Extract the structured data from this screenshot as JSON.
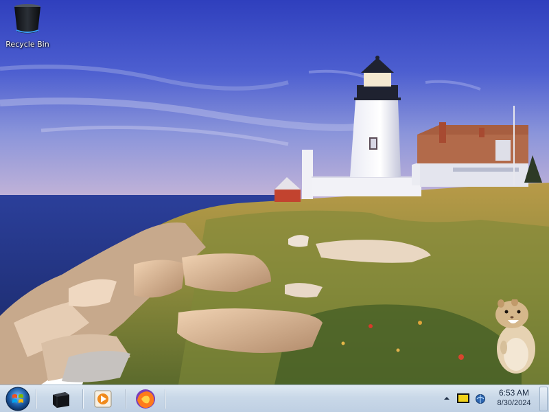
{
  "desktop": {
    "icons": [
      {
        "label": "Recycle Bin",
        "icon": "recycle-bin-icon"
      }
    ],
    "wallpaper": "lighthouse-coast",
    "gadget": "hamster-gadget"
  },
  "taskbar": {
    "start_icon": "windows-logo-icon",
    "pinned": [
      {
        "icon": "black-box-app-icon"
      },
      {
        "icon": "media-player-icon"
      },
      {
        "icon": "firefox-icon"
      }
    ],
    "tray": {
      "icons": [
        "show-hidden-icons-arrow",
        "action-center-icon",
        "network-icon"
      ],
      "time": "6:53 AM",
      "date": "8/30/2024"
    },
    "colors": {
      "accent": "#3a7bd5",
      "bar": "#c9d8e8"
    }
  }
}
